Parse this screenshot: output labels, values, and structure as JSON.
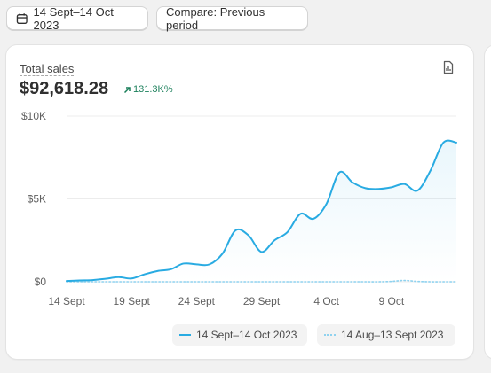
{
  "toolbar": {
    "date_range": "14 Sept–14 Oct 2023",
    "compare_label": "Compare: Previous period",
    "calendar_icon": "calendar-icon"
  },
  "card": {
    "title": "Total sales",
    "value": "$92,618.28",
    "change": "131.3K%",
    "change_icon": "arrow-up-right-icon",
    "report_icon": "report-icon"
  },
  "colors": {
    "current_series": "#29abe2",
    "previous_series": "#8fd2ef",
    "positive": "#1a7f5a"
  },
  "chart_data": {
    "type": "line",
    "y_ticks": [
      "$10K",
      "$5K",
      "$0"
    ],
    "x_ticks": [
      "14 Sept",
      "19 Sept",
      "24 Sept",
      "29 Sept",
      "4 Oct",
      "9 Oct"
    ],
    "ylim": [
      0,
      10000
    ],
    "grid": true,
    "legend_position": "bottom-right",
    "dates": [
      "14 Sept",
      "15 Sept",
      "16 Sept",
      "17 Sept",
      "18 Sept",
      "19 Sept",
      "20 Sept",
      "21 Sept",
      "22 Sept",
      "23 Sept",
      "24 Sept",
      "25 Sept",
      "26 Sept",
      "27 Sept",
      "28 Sept",
      "29 Sept",
      "30 Sept",
      "1 Oct",
      "2 Oct",
      "3 Oct",
      "4 Oct",
      "5 Oct",
      "6 Oct",
      "7 Oct",
      "8 Oct",
      "9 Oct",
      "10 Oct",
      "11 Oct",
      "12 Oct",
      "13 Oct",
      "14 Oct"
    ],
    "series": [
      {
        "name": "14 Sept–14 Oct 2023",
        "values": [
          50,
          80,
          100,
          180,
          280,
          200,
          450,
          650,
          750,
          1100,
          1050,
          1050,
          1700,
          3100,
          2800,
          1800,
          2500,
          3000,
          4100,
          3800,
          4700,
          6600,
          6000,
          5650,
          5600,
          5700,
          5900,
          5500,
          6700,
          8400,
          8400
        ],
        "style": "solid"
      },
      {
        "name": "14 Aug–13 Sept 2023",
        "values": [
          0,
          0,
          0,
          0,
          0,
          0,
          0,
          0,
          0,
          0,
          0,
          0,
          0,
          0,
          0,
          0,
          0,
          0,
          0,
          0,
          0,
          0,
          0,
          0,
          0,
          20,
          80,
          20,
          0,
          0,
          0
        ],
        "style": "dotted"
      }
    ]
  }
}
